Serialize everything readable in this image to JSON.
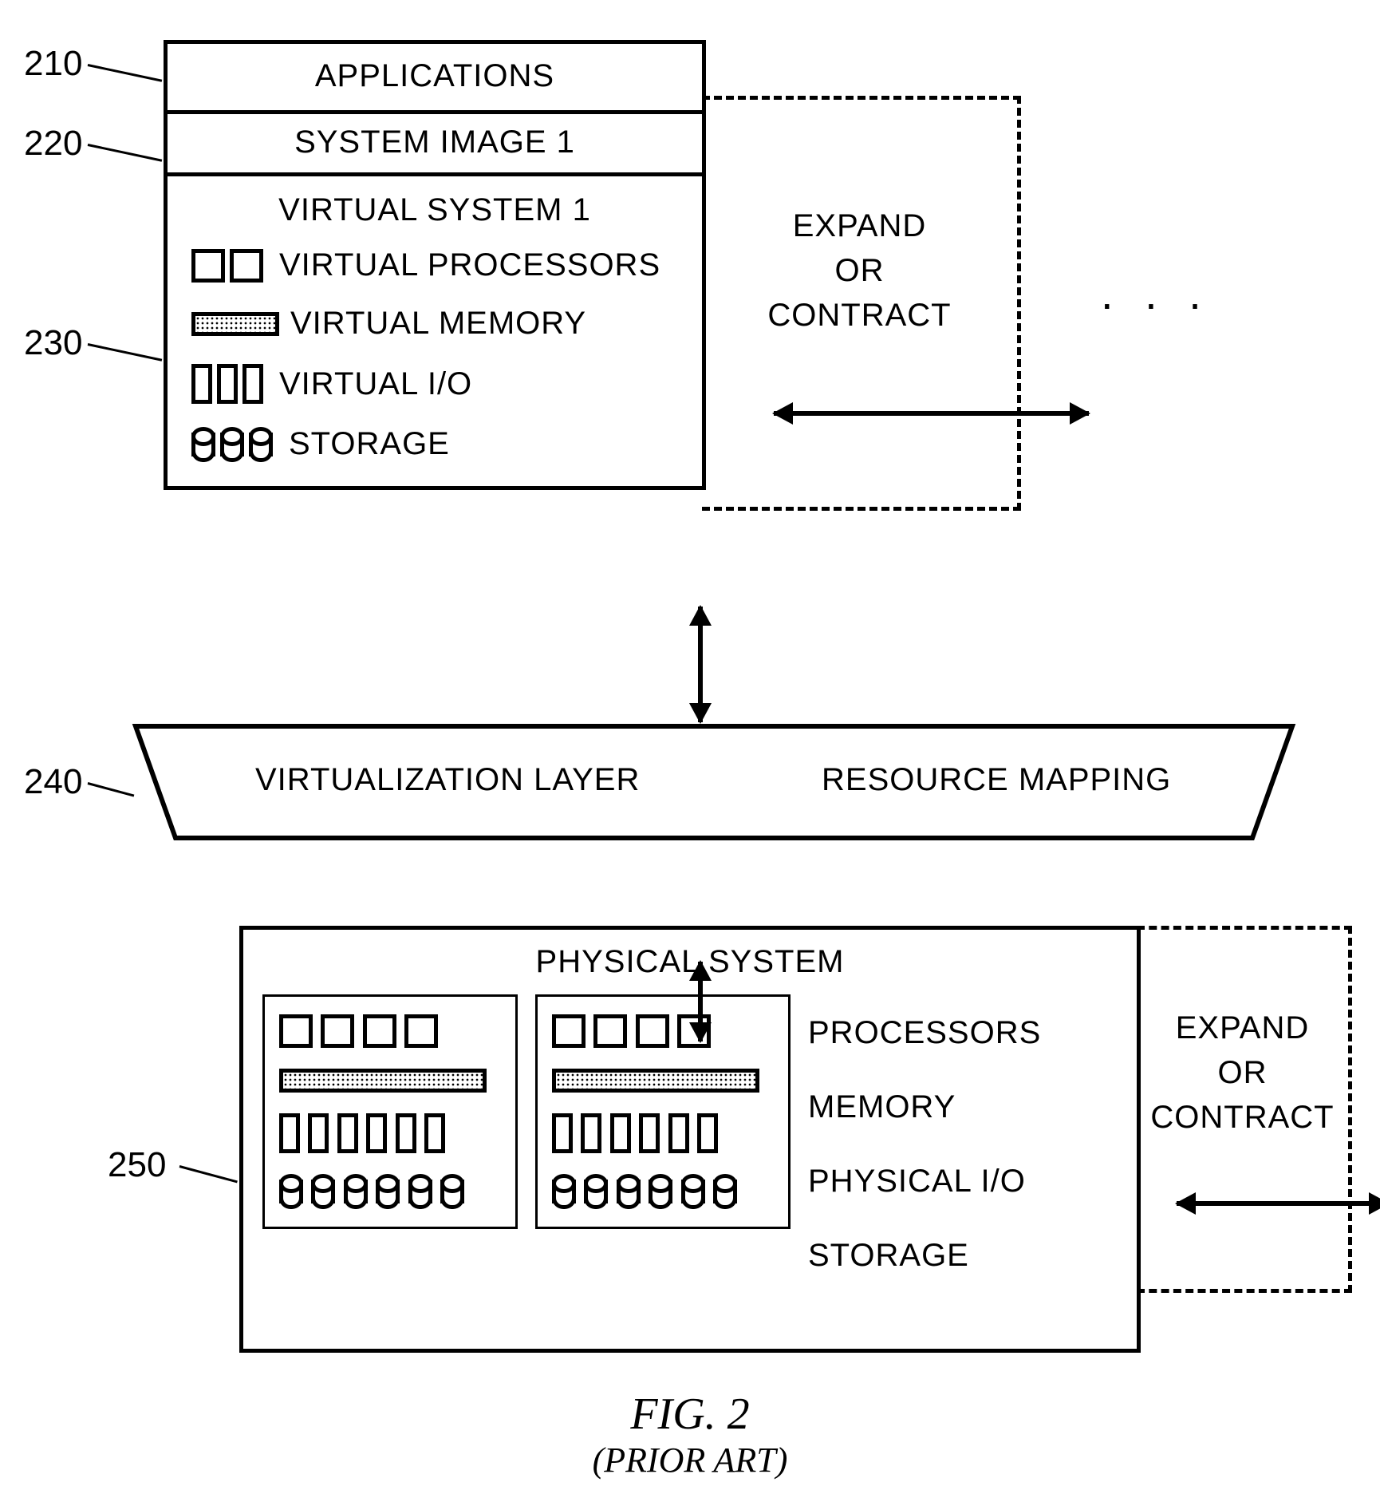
{
  "refs": {
    "r210": "210",
    "r220": "220",
    "r230": "230",
    "r240": "240",
    "r250": "250"
  },
  "virtual_stack": {
    "applications": "APPLICATIONS",
    "system_image": "SYSTEM IMAGE 1",
    "virtual_system_title": "VIRTUAL SYSTEM 1",
    "rows": {
      "processors": "VIRTUAL PROCESSORS",
      "memory": "VIRTUAL MEMORY",
      "io": "VIRTUAL I/O",
      "storage": "STORAGE"
    }
  },
  "expand_top": {
    "line1": "EXPAND",
    "line2": "OR",
    "line3": "CONTRACT"
  },
  "ellipsis": ". . .",
  "virt_layer": {
    "left": "VIRTUALIZATION LAYER",
    "right": "RESOURCE MAPPING"
  },
  "physical": {
    "title": "PHYSICAL SYSTEM",
    "labels": {
      "processors": "PROCESSORS",
      "memory": "MEMORY",
      "io": "PHYSICAL I/O",
      "storage": "STORAGE"
    }
  },
  "expand_bottom": {
    "line1": "EXPAND",
    "line2": "OR",
    "line3": "CONTRACT"
  },
  "figure": {
    "title": "FIG. 2",
    "sub": "(PRIOR ART)"
  }
}
